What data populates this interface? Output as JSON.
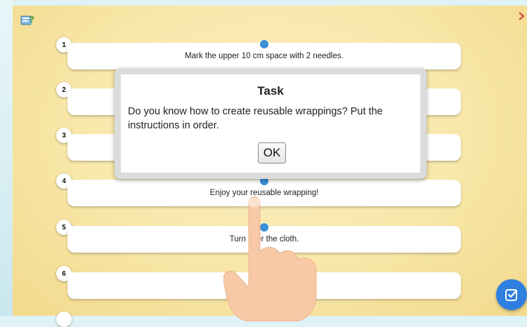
{
  "help_icon": "help-question-icon",
  "rows": [
    {
      "number": "1",
      "text": "Mark the upper 10 cm space with 2 needles."
    },
    {
      "number": "2",
      "text": ""
    },
    {
      "number": "3",
      "text": ""
    },
    {
      "number": "4",
      "text": "Enjoy your reusable wrapping!"
    },
    {
      "number": "5",
      "text": "Turn over the cloth."
    },
    {
      "number": "6",
      "text": ""
    }
  ],
  "dialog": {
    "title": "Task",
    "body": "Do you know how to create reusable wrappings? Put the instructions in order.",
    "ok_label": "OK"
  },
  "check_button_icon": "check-icon",
  "colors": {
    "accent": "#3a8fd6",
    "check_button": "#2f7fe0",
    "background": "#f8e7a8"
  }
}
